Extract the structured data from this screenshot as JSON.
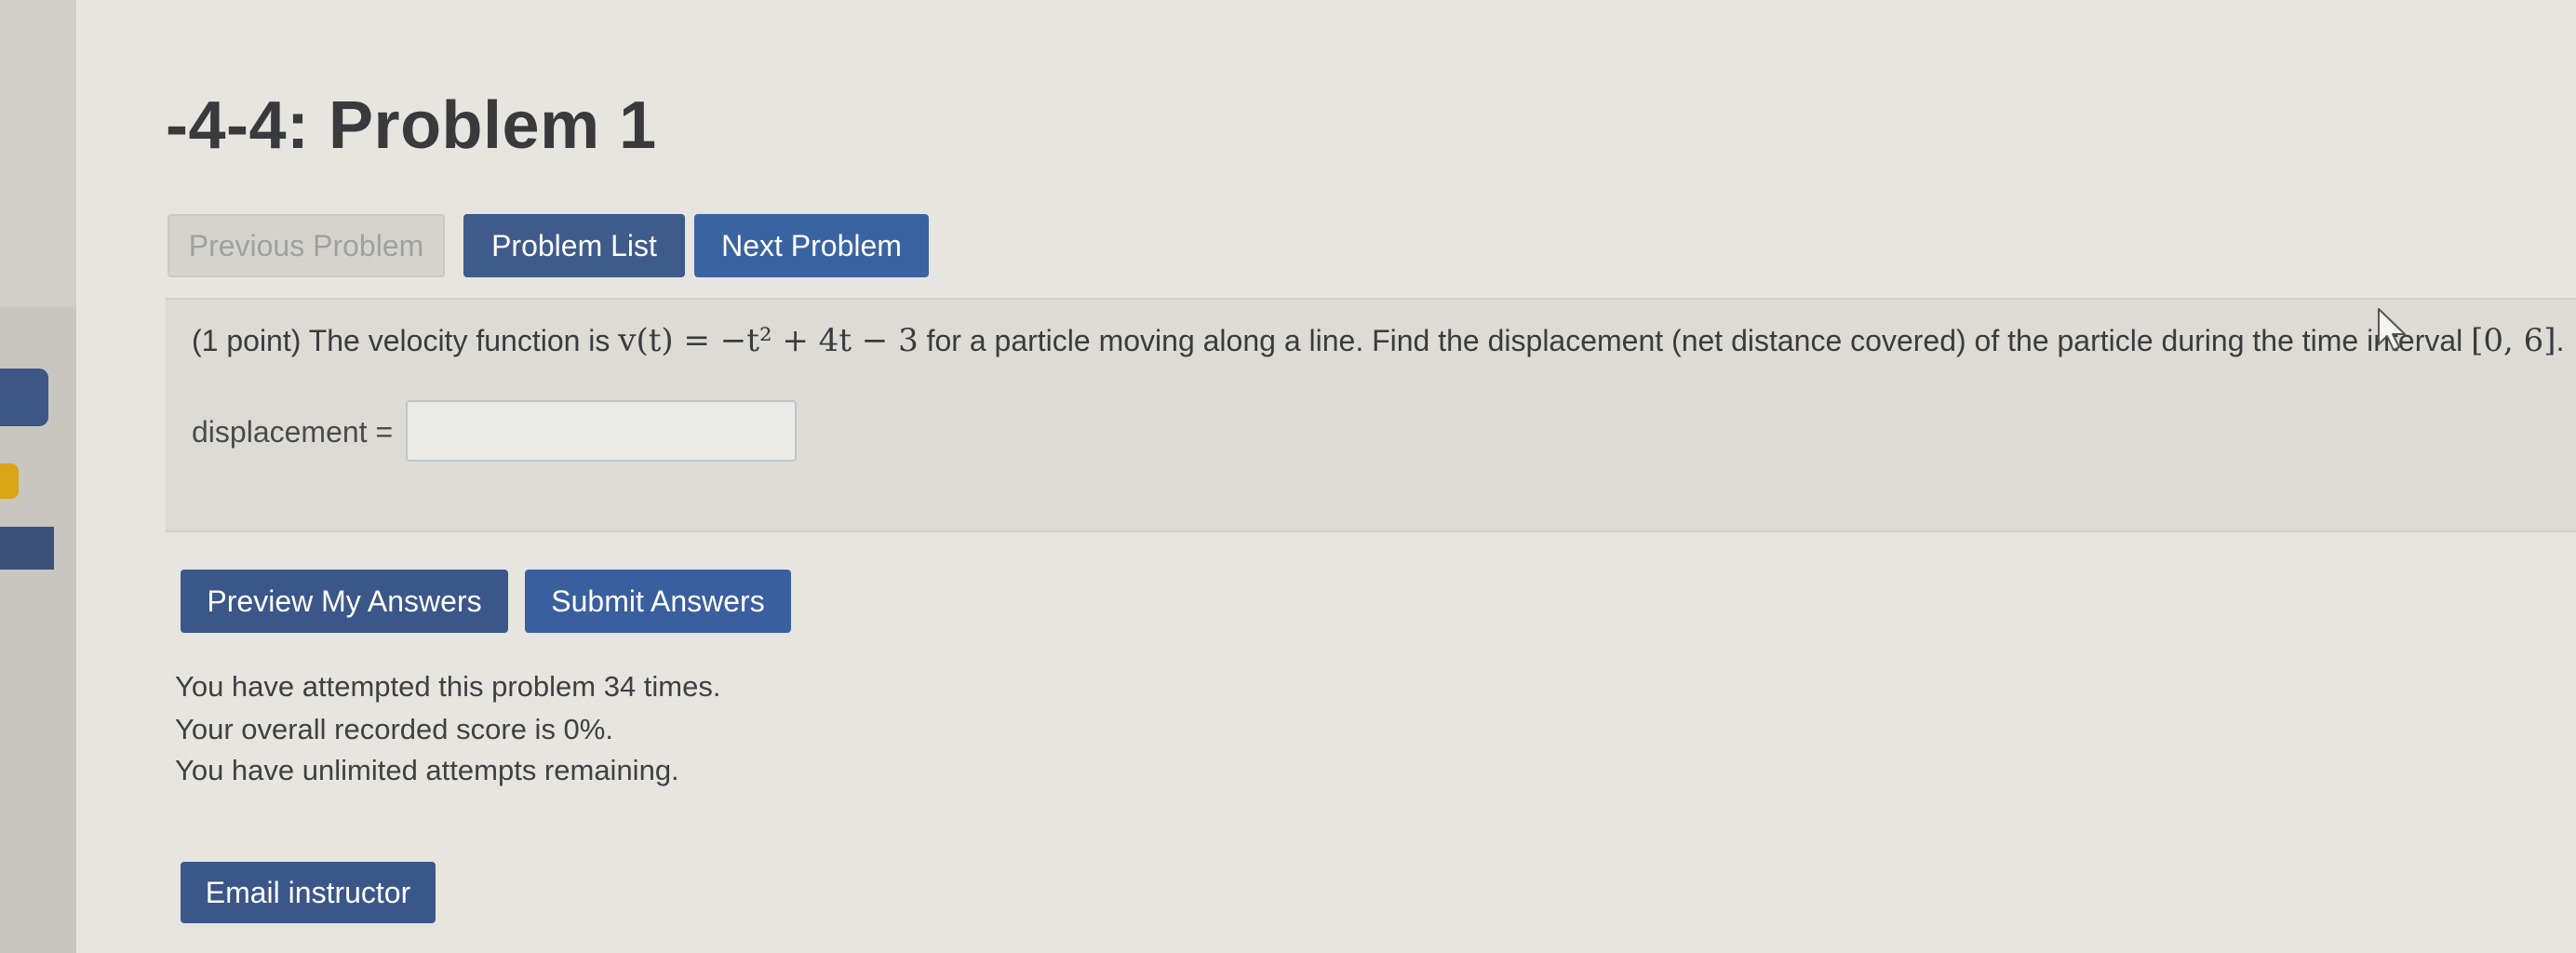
{
  "page": {
    "title": "-4-4: Problem 1"
  },
  "nav": {
    "previous_label": "Previous Problem",
    "list_label": "Problem List",
    "next_label": "Next Problem"
  },
  "problem": {
    "points": "(1 point)",
    "text_before": "The velocity function is",
    "velocity_function": "v(t) = −t² + 4t − 3",
    "text_after": "for a particle moving along a line. Find the displacement (net distance covered) of the particle during the time interval",
    "interval": "[0, 6]",
    "answer_label": "displacement =",
    "answer_value": ""
  },
  "actions": {
    "preview_label": "Preview My Answers",
    "submit_label": "Submit Answers",
    "email_label": "Email instructor"
  },
  "status": {
    "attempts": "You have attempted this problem 34 times.",
    "score": "Your overall recorded score is 0%.",
    "remaining": "You have unlimited attempts remaining."
  },
  "colors": {
    "primary_button": "#3b5688",
    "secondary_button": "#3a63a2",
    "disabled_button": "#d4d3ce",
    "sidebar_tab_yellow": "#d9a516"
  },
  "icons": {
    "cursor": "mouse-pointer-icon"
  }
}
